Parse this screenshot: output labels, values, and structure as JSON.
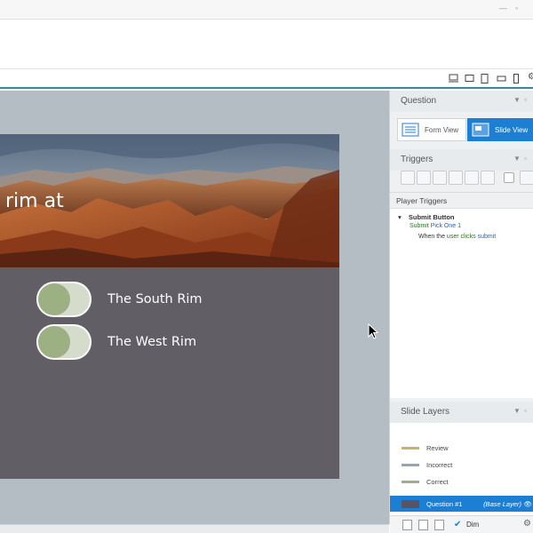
{
  "window": {
    "controls": [
      "minimize-icon",
      "restore-icon"
    ]
  },
  "device_bar": {
    "icons": [
      "monitor-icon",
      "tablet-landscape-icon",
      "tablet-portrait-icon",
      "phone-landscape-icon",
      "phone-portrait-icon",
      "gear-icon"
    ]
  },
  "slide": {
    "title_fragment": "rim at",
    "options": [
      {
        "label": "The South Rim"
      },
      {
        "label": "The West Rim"
      }
    ]
  },
  "question_panel": {
    "title": "Question",
    "form_view_label": "Form View",
    "slide_view_label": "Slide View",
    "active_view": "Slide View"
  },
  "triggers_panel": {
    "title": "Triggers",
    "player_triggers_label": "Player Triggers",
    "submit_button_label": "Submit Button",
    "trigger_action_prefix": "Submit",
    "trigger_action_target": "Pick One 1",
    "trigger_when": "When the",
    "trigger_user": "user",
    "trigger_clicks": "clicks",
    "trigger_object": "submit"
  },
  "layers_panel": {
    "title": "Slide Layers",
    "layers": [
      {
        "name": "Review",
        "color": "#c9b56a"
      },
      {
        "name": "Incorrect",
        "color": "#9aa3ab"
      },
      {
        "name": "Correct",
        "color": "#9db08a"
      }
    ],
    "base_layer": {
      "name": "Question #1",
      "tag": "(Base Layer)"
    },
    "dim_label": "Dim",
    "dim_checked": true
  },
  "colors": {
    "accent": "#1c7fd4",
    "teal_rule": "#2f8e9c",
    "slide_bg": "#625e66",
    "toggle_knob": "#9db084"
  }
}
